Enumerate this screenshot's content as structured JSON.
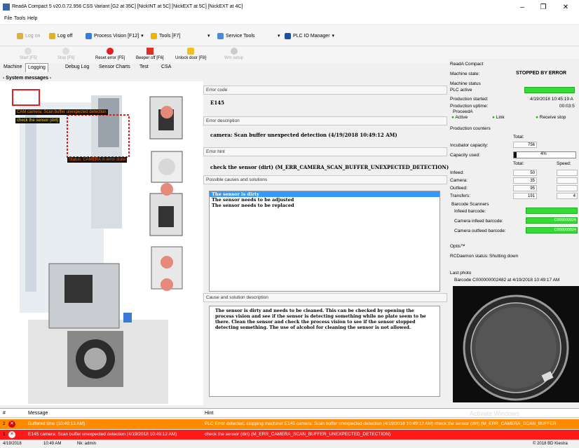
{
  "window": {
    "title": "ReadA Compact 5 v20.0.72.956 CSS Variant [G2 at 35C] [NickINT at 5C] [NickEXT at 5C] [NickEXT at 4C]",
    "minimize": "–",
    "restore": "❐",
    "close": "✕"
  },
  "menu": {
    "file": "File",
    "tools": "Tools",
    "help": "Help"
  },
  "toolbar": {
    "login": "Log on",
    "logoff": "Log off",
    "process_vision": "Process Vision [F12]",
    "tools": "Tools [F7]",
    "service_tools": "Service Tools",
    "plc_io": "PLC IO Manager"
  },
  "toolbar2": {
    "start": "Start [F5]",
    "stop": "Stop [F6]",
    "reset_error": "Reset error [F5]",
    "beeper_off": "Beeper off [F6]",
    "unlock_door": "Unlock door [F8]",
    "wm_setup": "Wm setup"
  },
  "tabs": [
    "Machine",
    "Logging",
    "Debug Log",
    "Sensor Charts",
    "Test",
    "CSA"
  ],
  "system_messages": "- System messages -",
  "overlay": {
    "msg1": "CAM camera: Scan buffer unexpected detection",
    "msg2": "check the sensor (dirt)",
    "msg3": "Status: CAMERA in error state"
  },
  "error_panel": {
    "code_label": "Error code",
    "code": "E145",
    "desc_label": "Error description",
    "description": "camera: Scan buffer unexpected detection  (4/19/2018 10:49:12 AM)",
    "hint_label": "Error hint",
    "hint": "check the sensor (dirt)  (M_ERR_CAMERA_SCAN_BUFFER_UNEXPECTED_DETECTION)",
    "causes_label": "Possible causes and solutions",
    "causes": [
      "The sensor is dirty",
      "The sensor needs to be adjusted",
      "The sensor needs to be replaced"
    ],
    "solution_label": "Cause and solution description",
    "solution": "The sensor is dirty and needs to be cleaned. This can be checked by opening the process vision and see if the sensor is detecting something while no plate seem to be there. Clean the sensor and check the process vision to see if the sensor stopped detecting something. The use of alcohol for cleaning the sensor is not allowed."
  },
  "right": {
    "app_name": "ReadA Compact",
    "machine_state_label": "Machine state:",
    "machine_state": "STOPPED BY ERROR",
    "machine_status": "Machine status",
    "plc_active": "PLC active",
    "production_started_label": "Production started:",
    "production_started": "4/19/2018 10:45:19 A",
    "production_uptime_label": "Production uptime:",
    "production_uptime": "00:03:5",
    "proceeda": "ProceedA",
    "active": "Active",
    "link": "Link",
    "receive_stop": "Receive stop",
    "production_counters": "Production counters",
    "total": "Total:",
    "incubator_capacity_label": "Incubator capacity:",
    "incubator_capacity": "756",
    "capacity_used_label": "Capacity used:",
    "capacity_used": "4%",
    "capacity_used_value": 0.04,
    "speed": "Speed:",
    "infeed_label": "Infeed:",
    "infeed": "50",
    "camera_label": "Camera:",
    "camera": "35",
    "outfeed_label": "Outfeed:",
    "outfeed": "95",
    "transfers_label": "Transfers:",
    "transfers": "191",
    "transfers_speed": "4",
    "barcode_scanners": "Barcode Scanners",
    "infeed_barcode": "Infeed barcode:",
    "camera_infeed_barcode": "Camera infeed barcode:",
    "camera_infeed_value": "C000000024",
    "camera_outfeed_barcode": "Camera outfeed barcode:",
    "camera_outfeed_value": "C000000024",
    "optis": "Optis™",
    "rcd_label": "RCDaemon status:",
    "rcd_status": "Shutting down",
    "last_photo": "Last photo",
    "barcode_line": "Barcode C000000002482 at 4/19/2018 10:49:17 AM"
  },
  "grid": {
    "col_num": "#",
    "col_message": "Message",
    "col_hint": "Hint",
    "rows": [
      {
        "num": "2",
        "message": "Buffered time (10:49:13 AM)",
        "hint": "PLC Error detected, stopping machine! E145 camera: Scan buffer unexpected detection (4/19/2018 10:49:12 AM) check the sensor (dirt) (M_ERR_CAMERA_SCAN_BUFFER"
      },
      {
        "num": "1",
        "message": "E145 camera: Scan buffer unexpected detection  (4/19/2018 10:49:12 AM)",
        "hint": "check the sensor (dirt)  (M_ERR_CAMERA_SCAN_BUFFER_UNEXPECTED_DETECTION)"
      }
    ]
  },
  "watermark": "Activate Windows",
  "status": {
    "date": "4/19/2018",
    "time": "10:49 AM",
    "user": "Nk: admin",
    "copyright": "© 2018 BD Kiestra"
  },
  "colors": {
    "error_red": "#ff1a1a",
    "warning_orange": "#ff8c00",
    "ok_green": "#33dd33",
    "selection_blue": "#3399ff"
  }
}
